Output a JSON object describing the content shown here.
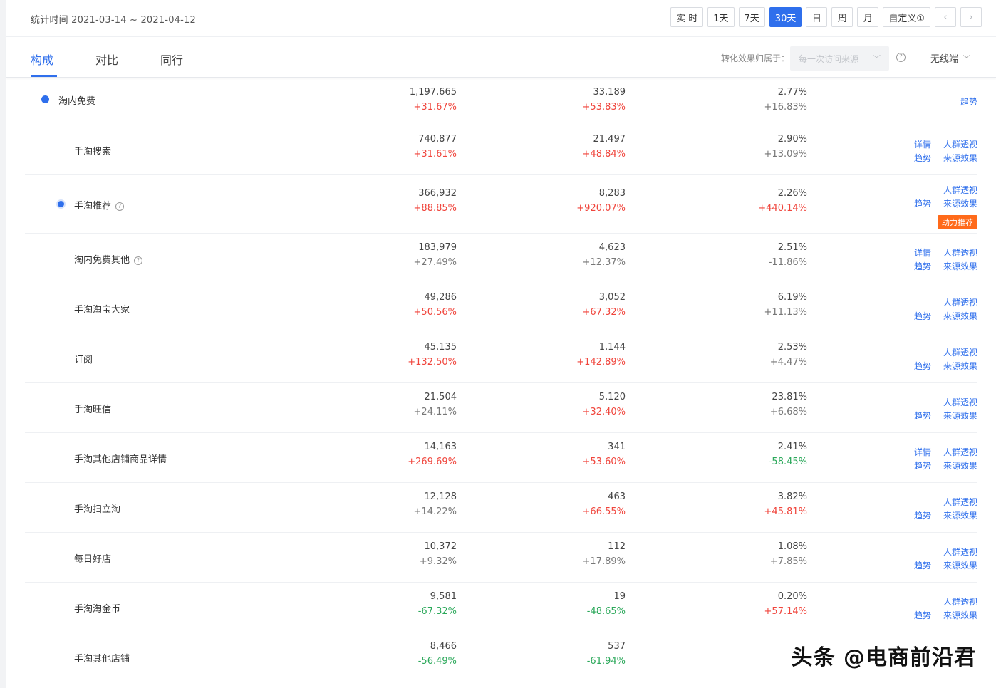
{
  "header": {
    "date_range": "统计时间 2021-03-14 ~ 2021-04-12",
    "periods": [
      {
        "label": "实 时",
        "active": false
      },
      {
        "label": "1天",
        "active": false
      },
      {
        "label": "7天",
        "active": false
      },
      {
        "label": "30天",
        "active": true
      },
      {
        "label": "日",
        "active": false
      },
      {
        "label": "周",
        "active": false
      },
      {
        "label": "月",
        "active": false
      },
      {
        "label": "自定义①",
        "active": false
      }
    ],
    "prev_icon": "‹",
    "next_icon": "›"
  },
  "tabs": [
    {
      "label": "构成",
      "active": true
    },
    {
      "label": "对比",
      "active": false
    },
    {
      "label": "同行",
      "active": false
    }
  ],
  "attribution": {
    "label": "转化效果归属于：",
    "selected": "每一次访问来源",
    "compare": "无线端"
  },
  "rows": [
    {
      "name": "淘内免费",
      "v1": "1,197,665",
      "c1": "+31.67%",
      "c1t": "up",
      "v2": "33,189",
      "c2": "+53.83%",
      "c2t": "up",
      "v3": "2.77%",
      "c3": "+16.83%",
      "c3t": "upgray",
      "actions": [
        "趋势"
      ],
      "badge": ""
    },
    {
      "name": "手淘搜索",
      "v1": "740,877",
      "c1": "+31.61%",
      "c1t": "up",
      "v2": "21,497",
      "c2": "+48.84%",
      "c2t": "up",
      "v3": "2.90%",
      "c3": "+13.09%",
      "c3t": "upgray",
      "actions": [
        "详情",
        "人群透视",
        "趋势",
        "来源效果"
      ],
      "badge": ""
    },
    {
      "name": "手淘推荐",
      "v1": "366,932",
      "c1": "+88.85%",
      "c1t": "up",
      "v2": "8,283",
      "c2": "+920.07%",
      "c2t": "up",
      "v3": "2.26%",
      "c3": "+440.14%",
      "c3t": "up",
      "actions": [
        "人群透视",
        "趋势",
        "来源效果"
      ],
      "badge": "助力推荐"
    },
    {
      "name": "淘内免费其他",
      "v1": "183,979",
      "c1": "+27.49%",
      "c1t": "upgray",
      "v2": "4,623",
      "c2": "+12.37%",
      "c2t": "upgray",
      "v3": "2.51%",
      "c3": "-11.86%",
      "c3t": "upgray",
      "actions": [
        "详情",
        "人群透视",
        "趋势",
        "来源效果"
      ],
      "badge": ""
    },
    {
      "name": "手淘淘宝大家",
      "v1": "49,286",
      "c1": "+50.56%",
      "c1t": "up",
      "v2": "3,052",
      "c2": "+67.32%",
      "c2t": "up",
      "v3": "6.19%",
      "c3": "+11.13%",
      "c3t": "upgray",
      "actions": [
        "人群透视",
        "趋势",
        "来源效果"
      ],
      "badge": ""
    },
    {
      "name": "订阅",
      "v1": "45,135",
      "c1": "+132.50%",
      "c1t": "up",
      "v2": "1,144",
      "c2": "+142.89%",
      "c2t": "up",
      "v3": "2.53%",
      "c3": "+4.47%",
      "c3t": "upgray",
      "actions": [
        "人群透视",
        "趋势",
        "来源效果"
      ],
      "badge": ""
    },
    {
      "name": "手淘旺信",
      "v1": "21,504",
      "c1": "+24.11%",
      "c1t": "upgray",
      "v2": "5,120",
      "c2": "+32.40%",
      "c2t": "up",
      "v3": "23.81%",
      "c3": "+6.68%",
      "c3t": "upgray",
      "actions": [
        "人群透视",
        "趋势",
        "来源效果"
      ],
      "badge": ""
    },
    {
      "name": "手淘其他店铺商品详情",
      "v1": "14,163",
      "c1": "+269.69%",
      "c1t": "up",
      "v2": "341",
      "c2": "+53.60%",
      "c2t": "up",
      "v3": "2.41%",
      "c3": "-58.45%",
      "c3t": "down",
      "actions": [
        "详情",
        "人群透视",
        "趋势",
        "来源效果"
      ],
      "badge": ""
    },
    {
      "name": "手淘扫立淘",
      "v1": "12,128",
      "c1": "+14.22%",
      "c1t": "upgray",
      "v2": "463",
      "c2": "+66.55%",
      "c2t": "up",
      "v3": "3.82%",
      "c3": "+45.81%",
      "c3t": "up",
      "actions": [
        "人群透视",
        "趋势",
        "来源效果"
      ],
      "badge": ""
    },
    {
      "name": "每日好店",
      "v1": "10,372",
      "c1": "+9.32%",
      "c1t": "upgray",
      "v2": "112",
      "c2": "+17.89%",
      "c2t": "upgray",
      "v3": "1.08%",
      "c3": "+7.85%",
      "c3t": "upgray",
      "actions": [
        "人群透视",
        "趋势",
        "来源效果"
      ],
      "badge": ""
    },
    {
      "name": "手淘淘金币",
      "v1": "9,581",
      "c1": "-67.32%",
      "c1t": "down",
      "v2": "19",
      "c2": "-48.65%",
      "c2t": "down",
      "v3": "0.20%",
      "c3": "+57.14%",
      "c3t": "up",
      "actions": [
        "人群透视",
        "趋势",
        "来源效果"
      ],
      "badge": ""
    },
    {
      "name": "手淘其他店铺",
      "v1": "8,466",
      "c1": "-56.49%",
      "c1t": "down",
      "v2": "537",
      "c2": "-61.94%",
      "c2t": "down",
      "v3": "",
      "c3": "",
      "c3t": "upgray",
      "actions": [],
      "badge": ""
    }
  ],
  "watermark": "头条 @电商前沿君"
}
